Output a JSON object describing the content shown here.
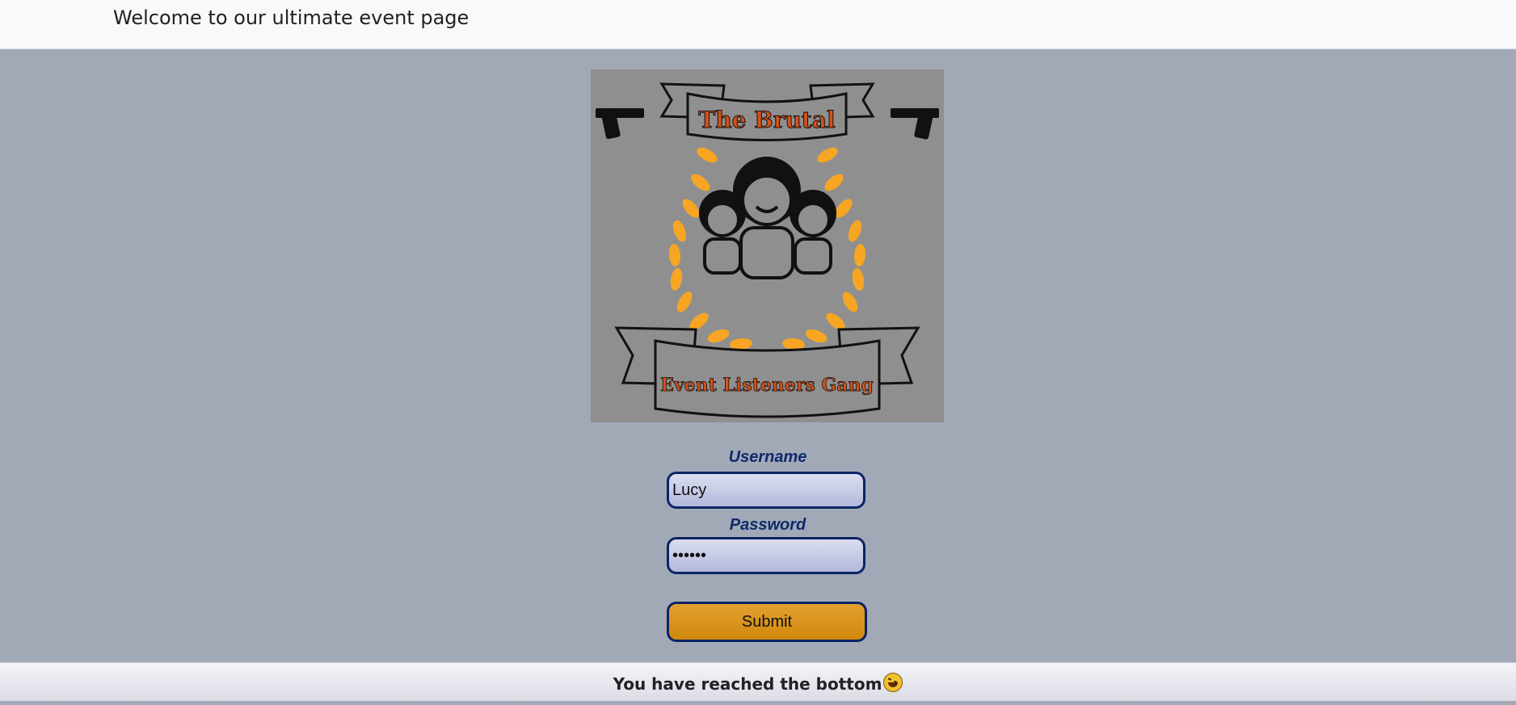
{
  "header": {
    "title": "Welcome to our ultimate event page"
  },
  "logo": {
    "top_banner": "The Brutal",
    "bottom_banner": "Event Listeners Gang",
    "background_color": "#8f8f8f",
    "laurel_color": "#f6a623",
    "banner_text_color": "#d4521a"
  },
  "form": {
    "username_label": "Username",
    "username_value": "Lucy",
    "password_label": "Password",
    "password_value": "••••••",
    "submit_label": "Submit"
  },
  "footer": {
    "text": "You have reached the bottom",
    "emoji_icon": "laughing-face-icon"
  },
  "colors": {
    "page_bg": "#a2a9b6",
    "accent": "#0b2464",
    "submit": "#d88f14"
  }
}
